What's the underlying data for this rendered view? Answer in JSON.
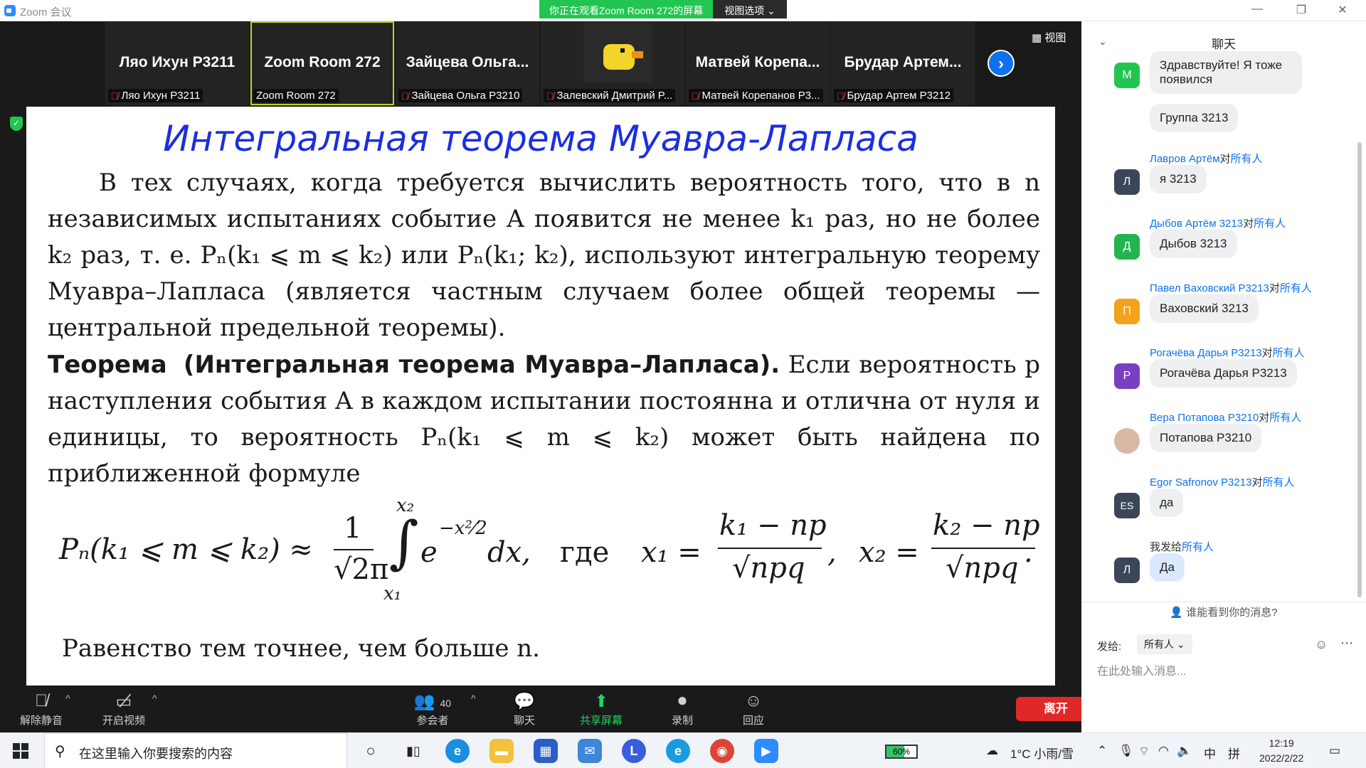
{
  "window": {
    "title": "Zoom 会议",
    "share_banner": "你正在观看Zoom Room 272的屏幕",
    "view_options": "视图选项 ⌄"
  },
  "gallery": {
    "view_label": "视图",
    "tiles": [
      {
        "big": "Ляо Ихун P3211",
        "small": "Ляо Ихун P3211",
        "muted": true
      },
      {
        "big": "Zoom Room 272",
        "small": "Zoom Room 272",
        "muted": false
      },
      {
        "big": "Зайцева  Ольга...",
        "small": "Зайцева Ольга P3210",
        "muted": true
      },
      {
        "big": "",
        "small": "Залевский Дмитрий P...",
        "muted": true
      },
      {
        "big": "Матвей  Корепа...",
        "small": "Матвей Корепанов P3...",
        "muted": true
      },
      {
        "big": "Брудар  Артем...",
        "small": "Брудар Артем P3212",
        "muted": true
      }
    ]
  },
  "slide": {
    "title": "Интегральная теорема Муавра-Лапласа",
    "para1": "В тех случаях, когда требуется вычислить вероятность того, что в n независимых испытаниях событие A появится не менее k₁ раз, но не более k₂ раз, т. е. Pₙ(k₁ ⩽ m ⩽ k₂) или Pₙ(k₁; k₂), используют интегральную теорему Муавра–Лапласа (является частным случаем более общей теоремы — центральной предельной теоремы).",
    "theorem_head": "Теорема",
    "theorem_name": "(Интегральная теорема Муавра–Лапласа).",
    "para2": "Если вероятность p наступления события A в каждом испытании постоянна и отлична от нуля и единицы, то вероятность Pₙ(k₁ ⩽ m ⩽ k₂) может быть найдена по приближенной формуле",
    "formula": {
      "lhs": "Pₙ(k₁ ⩽ m ⩽ k₂) ≈",
      "one": "1",
      "sqrt2pi": "√2π",
      "integral": "∫",
      "upper": "x₂",
      "lower": "x₁",
      "exp": "e",
      "exp_power": "−x²⁄2",
      "dx": "dx,",
      "where": "где",
      "x1": "x₁ =",
      "num1": "k₁ − np",
      "den1": "√npq",
      "comma": ",",
      "x2": "x₂ =",
      "num2": "k₂ − np",
      "den2": "√npq",
      "dot": "."
    },
    "final": "Равенство  тем точнее, чем больше n."
  },
  "toolbar": {
    "unmute": "解除静音",
    "start_video": "开启视频",
    "participants": "参会者",
    "participants_count": "40",
    "chat": "聊天",
    "share": "共享屏幕",
    "record": "录制",
    "reactions": "回应",
    "leave": "离开"
  },
  "chat": {
    "title": "聊天",
    "messages": [
      {
        "sender": "",
        "to": "",
        "audience": "",
        "avatar": "М",
        "avatar_color": "#23c552",
        "text": "Здравствуйте! Я тоже появился"
      },
      {
        "sender": "",
        "to": "",
        "audience": "",
        "avatar": "",
        "avatar_color": "",
        "text": "Группа 3213"
      },
      {
        "sender": "Лавров Артём",
        "to": "对",
        "audience": "所有人",
        "avatar": "Л",
        "avatar_color": "#3b4758",
        "text": "я 3213"
      },
      {
        "sender": "Дыбов Артём 3213",
        "to": "对",
        "audience": "所有人",
        "avatar": "Д",
        "avatar_color": "#23b44e",
        "text": "Дыбов 3213"
      },
      {
        "sender": "Павел Ваховский P3213",
        "to": "对",
        "audience": "所有人",
        "avatar": "П",
        "avatar_color": "#f2a21b",
        "text": "Ваховский 3213"
      },
      {
        "sender": "Рогачёва Дарья P3213",
        "to": "对",
        "audience": "所有人",
        "avatar": "Р",
        "avatar_color": "#7a3fc1",
        "text": "Рогачёва Дарья P3213"
      },
      {
        "sender": "Вера Потапова P3210",
        "to": "对",
        "audience": "所有人",
        "avatar": "",
        "avatar_color": "#d9b8a4",
        "text": "Потапова P3210"
      },
      {
        "sender": "Egor Safronov P3213",
        "to": "对",
        "audience": "所有人",
        "avatar": "ES",
        "avatar_color": "#3b4758",
        "text": "да"
      },
      {
        "sender": "我发给",
        "to": "",
        "audience": "所有人",
        "avatar": "Л",
        "avatar_color": "#3b4758",
        "text": "Да"
      }
    ],
    "privacy": "谁能看到你的消息?",
    "send_to_label": "发给:",
    "send_to_value": "所有人 ⌄",
    "placeholder": "在此处输入消息..."
  },
  "taskbar": {
    "search_placeholder": "在这里输入你要搜索的内容",
    "battery": "60%",
    "weather": "1°C  小雨/雪",
    "ime1": "中",
    "ime2": "拼",
    "time": "12:19",
    "date": "2022/2/22"
  }
}
